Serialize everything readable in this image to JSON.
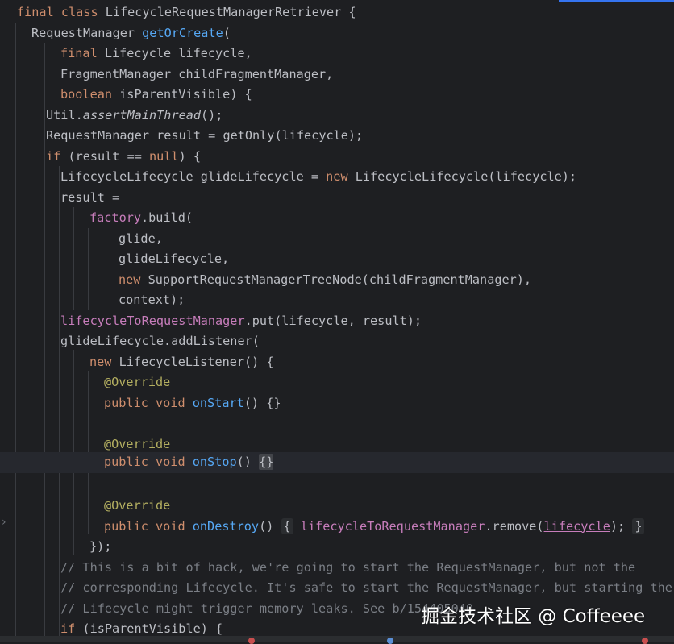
{
  "colors": {
    "background": "#1e1f22",
    "keyword": "#cf8e6d",
    "method": "#56a8f5",
    "field": "#c77dbb",
    "annotation": "#b3ae60",
    "comment": "#7a7e85",
    "text": "#bcbec4"
  },
  "icons": {
    "fold_toggle": "chevron-right-icon"
  },
  "watermark": "掘金技术社区 @ Coffeeee",
  "code": {
    "l1": {
      "a": "final",
      "b": " ",
      "c": "class",
      "d": " LifecycleRequestManagerRetriever {"
    },
    "l2": {
      "a": "RequestManager ",
      "b": "getOrCreate",
      "c": "("
    },
    "l3": {
      "a": "final",
      "b": " Lifecycle lifecycle,"
    },
    "l4": {
      "a": "FragmentManager childFragmentManager,"
    },
    "l5": {
      "a": "boolean",
      "b": " isParentVisible) {"
    },
    "l6": {
      "a": "Util.",
      "b": "assertMainThread",
      "c": "();"
    },
    "l7": {
      "a": "RequestManager result = getOnly(lifecycle);"
    },
    "l8": {
      "a": "if",
      "b": " (result == ",
      "c": "null",
      "d": ") {"
    },
    "l9": {
      "a": "LifecycleLifecycle glideLifecycle = ",
      "b": "new",
      "c": " LifecycleLifecycle(lifecycle);"
    },
    "l10": {
      "a": "result ="
    },
    "l11": {
      "a": "factory",
      "b": ".build("
    },
    "l12": {
      "a": "glide,"
    },
    "l13": {
      "a": "glideLifecycle,"
    },
    "l14": {
      "a": "new",
      "b": " SupportRequestManagerTreeNode(childFragmentManager),"
    },
    "l15": {
      "a": "context);"
    },
    "l16": {
      "a": "lifecycleToRequestManager",
      "b": ".put(lifecycle, result);"
    },
    "l17": {
      "a": "glideLifecycle.addListener("
    },
    "l18": {
      "a": "new",
      "b": " LifecycleListener() {"
    },
    "l19": {
      "a": "@Override"
    },
    "l20": {
      "a": "public",
      "b": " ",
      "c": "void",
      "d": " ",
      "e": "onStart",
      "f": "() {}"
    },
    "l22": {
      "a": "@Override"
    },
    "l23": {
      "a": "public",
      "b": " ",
      "c": "void",
      "d": " ",
      "e": "onStop",
      "f": "() ",
      "g": "{}"
    },
    "l25": {
      "a": "@Override"
    },
    "l26": {
      "a": "public",
      "b": " ",
      "c": "void",
      "d": " ",
      "e": "onDestroy",
      "f": "() ",
      "g": "{",
      "h": " ",
      "i": "lifecycleToRequestManager",
      "j": ".remove(",
      "k": "lifecycle",
      "l": ");",
      "m": " ",
      "n": "}"
    },
    "l27": {
      "a": "});"
    },
    "l28": {
      "a": "// This is a bit of hack, we're going to start the RequestManager, but not the"
    },
    "l29": {
      "a": "// corresponding Lifecycle. It's safe to start the RequestManager, but starting the"
    },
    "l30": {
      "a": "// Lifecycle might trigger memory leaks. See b/154405040"
    },
    "l31": {
      "a": "if",
      "b": " (isParentVisible) {"
    }
  }
}
